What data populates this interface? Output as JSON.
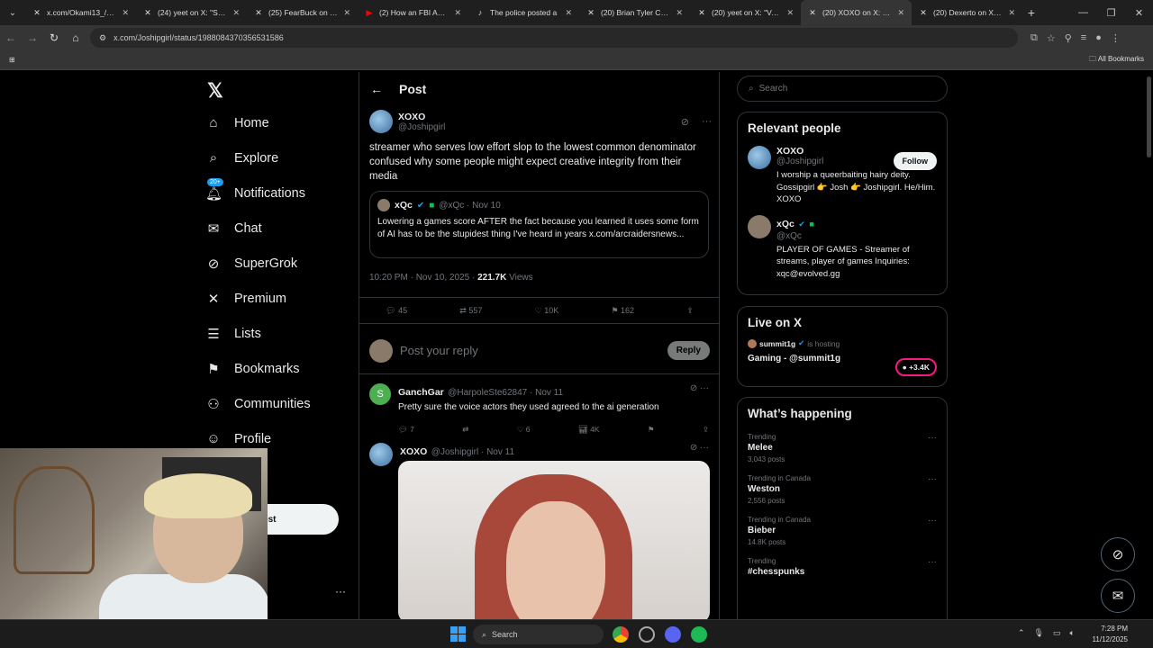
{
  "browser": {
    "tabs": [
      {
        "title": "x.com/Okami13_/stat",
        "icon": "x-logo-icon"
      },
      {
        "title": "(24) yeet on X: \"Sneak",
        "icon": "x-logo-icon"
      },
      {
        "title": "(25) FearBuck on X: \"I",
        "icon": "x-logo-icon"
      },
      {
        "title": "(2) How an FBI Agent",
        "icon": "youtube-icon"
      },
      {
        "title": "The police posted a",
        "icon": "tiktok-icon"
      },
      {
        "title": "(20) Brian Tyler Cohe",
        "icon": "x-logo-icon"
      },
      {
        "title": "(20) yeet on X: \"Valky",
        "icon": "x-logo-icon"
      },
      {
        "title": "(20) XOXO on X: \"stre",
        "icon": "x-logo-icon",
        "active": true
      },
      {
        "title": "(20) Dexerto on X: \"A",
        "icon": "x-logo-icon"
      }
    ],
    "url": "x.com/Joshipgirl/status/1988084370356531586",
    "bookmarks_label": "All Bookmarks"
  },
  "nav": {
    "items": [
      {
        "label": "Home",
        "icon": "home-icon",
        "glyph": "⌂"
      },
      {
        "label": "Explore",
        "icon": "search-icon",
        "glyph": "⌕"
      },
      {
        "label": "Notifications",
        "icon": "bell-icon",
        "glyph": "♫"
      },
      {
        "label": "Chat",
        "icon": "mail-icon",
        "glyph": "✉"
      },
      {
        "label": "SuperGrok",
        "icon": "grok-icon",
        "glyph": "⊘"
      },
      {
        "label": "Premium",
        "icon": "x-logo-icon",
        "glyph": "✕"
      },
      {
        "label": "Lists",
        "icon": "list-icon",
        "glyph": "☰"
      },
      {
        "label": "Bookmarks",
        "icon": "bookmark-icon",
        "glyph": "⚑"
      },
      {
        "label": "Communities",
        "icon": "people-icon",
        "glyph": "⚇"
      },
      {
        "label": "Profile",
        "icon": "user-icon",
        "glyph": "☺"
      }
    ],
    "notif_badge": "20+",
    "post_label": "ost"
  },
  "header": {
    "title": "Post"
  },
  "post": {
    "name": "XOXO",
    "handle": "@Joshipgirl",
    "text": "streamer who serves low effort slop to the lowest common denominator confused why some people might expect creative integrity from their media",
    "quote": {
      "name": "xQc",
      "handle": "@xQc · Nov 10",
      "text": "Lowering a games score AFTER the fact because you learned it uses some form of AI has to be the stupidest thing I've heard in years x.com/arcraidersnews..."
    },
    "time": "10:20 PM · Nov 10, 2025 · ",
    "views": "221.7K",
    "views_label": " Views",
    "replies": "45",
    "reposts": "557",
    "likes": "10K",
    "bookmarks": "162"
  },
  "reply_box": {
    "placeholder": "Post your reply",
    "button": "Reply"
  },
  "replies": [
    {
      "name": "GanchGar",
      "handle": "@HarpoleSte62847 · Nov 11",
      "text": "Pretty sure the voice actors they used agreed to the ai generation",
      "replies": "7",
      "reposts": "",
      "likes": "6",
      "views": "4K",
      "avatar_letter": "S"
    },
    {
      "name": "XOXO",
      "handle": "@Joshipgirl · Nov 11"
    }
  ],
  "sidebar": {
    "search_placeholder": "Search",
    "relevant_title": "Relevant people",
    "people": [
      {
        "name": "XOXO",
        "handle": "@Joshipgirl",
        "bio": "I worship a queerbaiting hairy deity. Gossipgirl 👉 Josh 👉 Joshipgirl. He/Him. XOXO",
        "follow": "Follow"
      },
      {
        "name": "xQc",
        "handle": "@xQc",
        "bio": "PLAYER OF GAMES - Streamer of streams, player of games Inquiries: xqc@evolved.gg"
      }
    ],
    "live_title": "Live on X",
    "live": {
      "host": "summit1g",
      "hosting": "is hosting",
      "title": "Gaming - @summit1g",
      "count": "+3.4K"
    },
    "happening_title": "What’s happening",
    "trends": [
      {
        "sub": "Trending",
        "name": "Melee",
        "count": "3,043 posts"
      },
      {
        "sub": "Trending in Canada",
        "name": "Weston",
        "count": "2,556 posts"
      },
      {
        "sub": "Trending in Canada",
        "name": "Bieber",
        "count": "14.8K posts"
      },
      {
        "sub": "Trending",
        "name": "#chesspunks",
        "count": ""
      }
    ]
  },
  "taskbar": {
    "search": "Search",
    "time": "7:28 PM",
    "date": "11/12/2025"
  },
  "colors": {
    "accent": "#1d9bf0",
    "background": "#000000",
    "border": "#2f3336",
    "muted": "#71767b"
  }
}
